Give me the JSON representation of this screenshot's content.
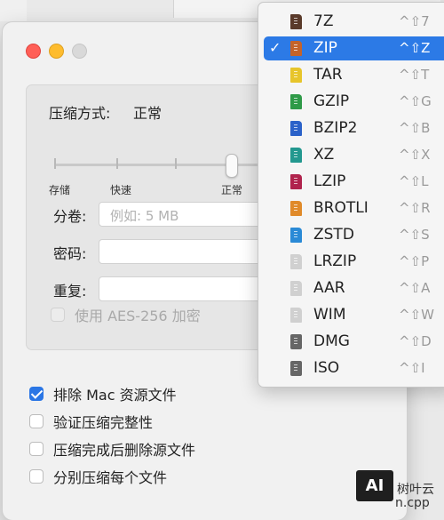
{
  "panel": {
    "compression_label": "压缩方式:",
    "compression_value": "正常",
    "levels": [
      "存储",
      "快速",
      "正常"
    ],
    "split_label": "分卷:",
    "split_placeholder": "例如: 5 MB",
    "password_label": "密码:",
    "repeat_label": "重复:",
    "aes_label": "使用 AES-256 加密",
    "aes_checked": false
  },
  "options": [
    {
      "label": "排除 Mac 资源文件",
      "checked": true
    },
    {
      "label": "验证压缩完整性",
      "checked": false
    },
    {
      "label": "压缩完成后删除源文件",
      "checked": false
    },
    {
      "label": "分别压缩每个文件",
      "checked": false
    }
  ],
  "format_menu": {
    "selected": "ZIP",
    "items": [
      {
        "label": "7Z",
        "shortcut": "^⇧7",
        "icon": "archive-icon",
        "color": "#5a3a2a"
      },
      {
        "label": "ZIP",
        "shortcut": "^⇧Z",
        "icon": "archive-icon",
        "color": "#c4632a"
      },
      {
        "label": "TAR",
        "shortcut": "^⇧T",
        "icon": "archive-icon",
        "color": "#e7c52b"
      },
      {
        "label": "GZIP",
        "shortcut": "^⇧G",
        "icon": "archive-icon",
        "color": "#2f9a48"
      },
      {
        "label": "BZIP2",
        "shortcut": "^⇧B",
        "icon": "archive-icon",
        "color": "#2b62c9"
      },
      {
        "label": "XZ",
        "shortcut": "^⇧X",
        "icon": "archive-icon",
        "color": "#23988f"
      },
      {
        "label": "LZIP",
        "shortcut": "^⇧L",
        "icon": "archive-icon",
        "color": "#b0234d"
      },
      {
        "label": "BROTLI",
        "shortcut": "^⇧R",
        "icon": "archive-icon",
        "color": "#e08a2a"
      },
      {
        "label": "ZSTD",
        "shortcut": "^⇧S",
        "icon": "archive-icon",
        "color": "#2a8ad6"
      },
      {
        "label": "LRZIP",
        "shortcut": "^⇧P",
        "icon": "archive-icon",
        "color": "#d0d0d0"
      },
      {
        "label": "AAR",
        "shortcut": "^⇧A",
        "icon": "archive-icon",
        "color": "#d0d0d0"
      },
      {
        "label": "WIM",
        "shortcut": "^⇧W",
        "icon": "archive-icon",
        "color": "#d0d0d0"
      },
      {
        "label": "DMG",
        "shortcut": "^⇧D",
        "icon": "disk-image-icon",
        "color": "#666666"
      },
      {
        "label": "ISO",
        "shortcut": "^⇧I",
        "icon": "disk-image-icon",
        "color": "#666666"
      }
    ]
  },
  "watermark": {
    "logo": "AI",
    "name": "树叶云",
    "url": "n.cpp"
  }
}
